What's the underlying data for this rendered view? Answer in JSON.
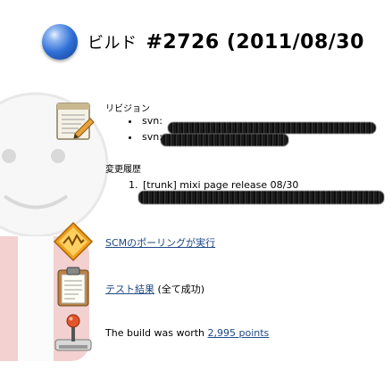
{
  "build": {
    "title_prefix": "ビルド",
    "title": "#2726 (2011/08/30"
  },
  "revision": {
    "heading": "リビジョン",
    "items": [
      "svn:",
      "svn:"
    ]
  },
  "changes": {
    "heading": "変更履歴",
    "items": [
      "[trunk] mixi page release 08/30"
    ]
  },
  "scm": {
    "link": "SCMのポーリングが実行"
  },
  "tests": {
    "link": "テスト結果",
    "status": "(全て成功)"
  },
  "worth": {
    "text": "The build was worth",
    "points_link": "2,995 points"
  },
  "colors": {
    "status_ball": "#2f6fd6",
    "link": "#204a87"
  }
}
